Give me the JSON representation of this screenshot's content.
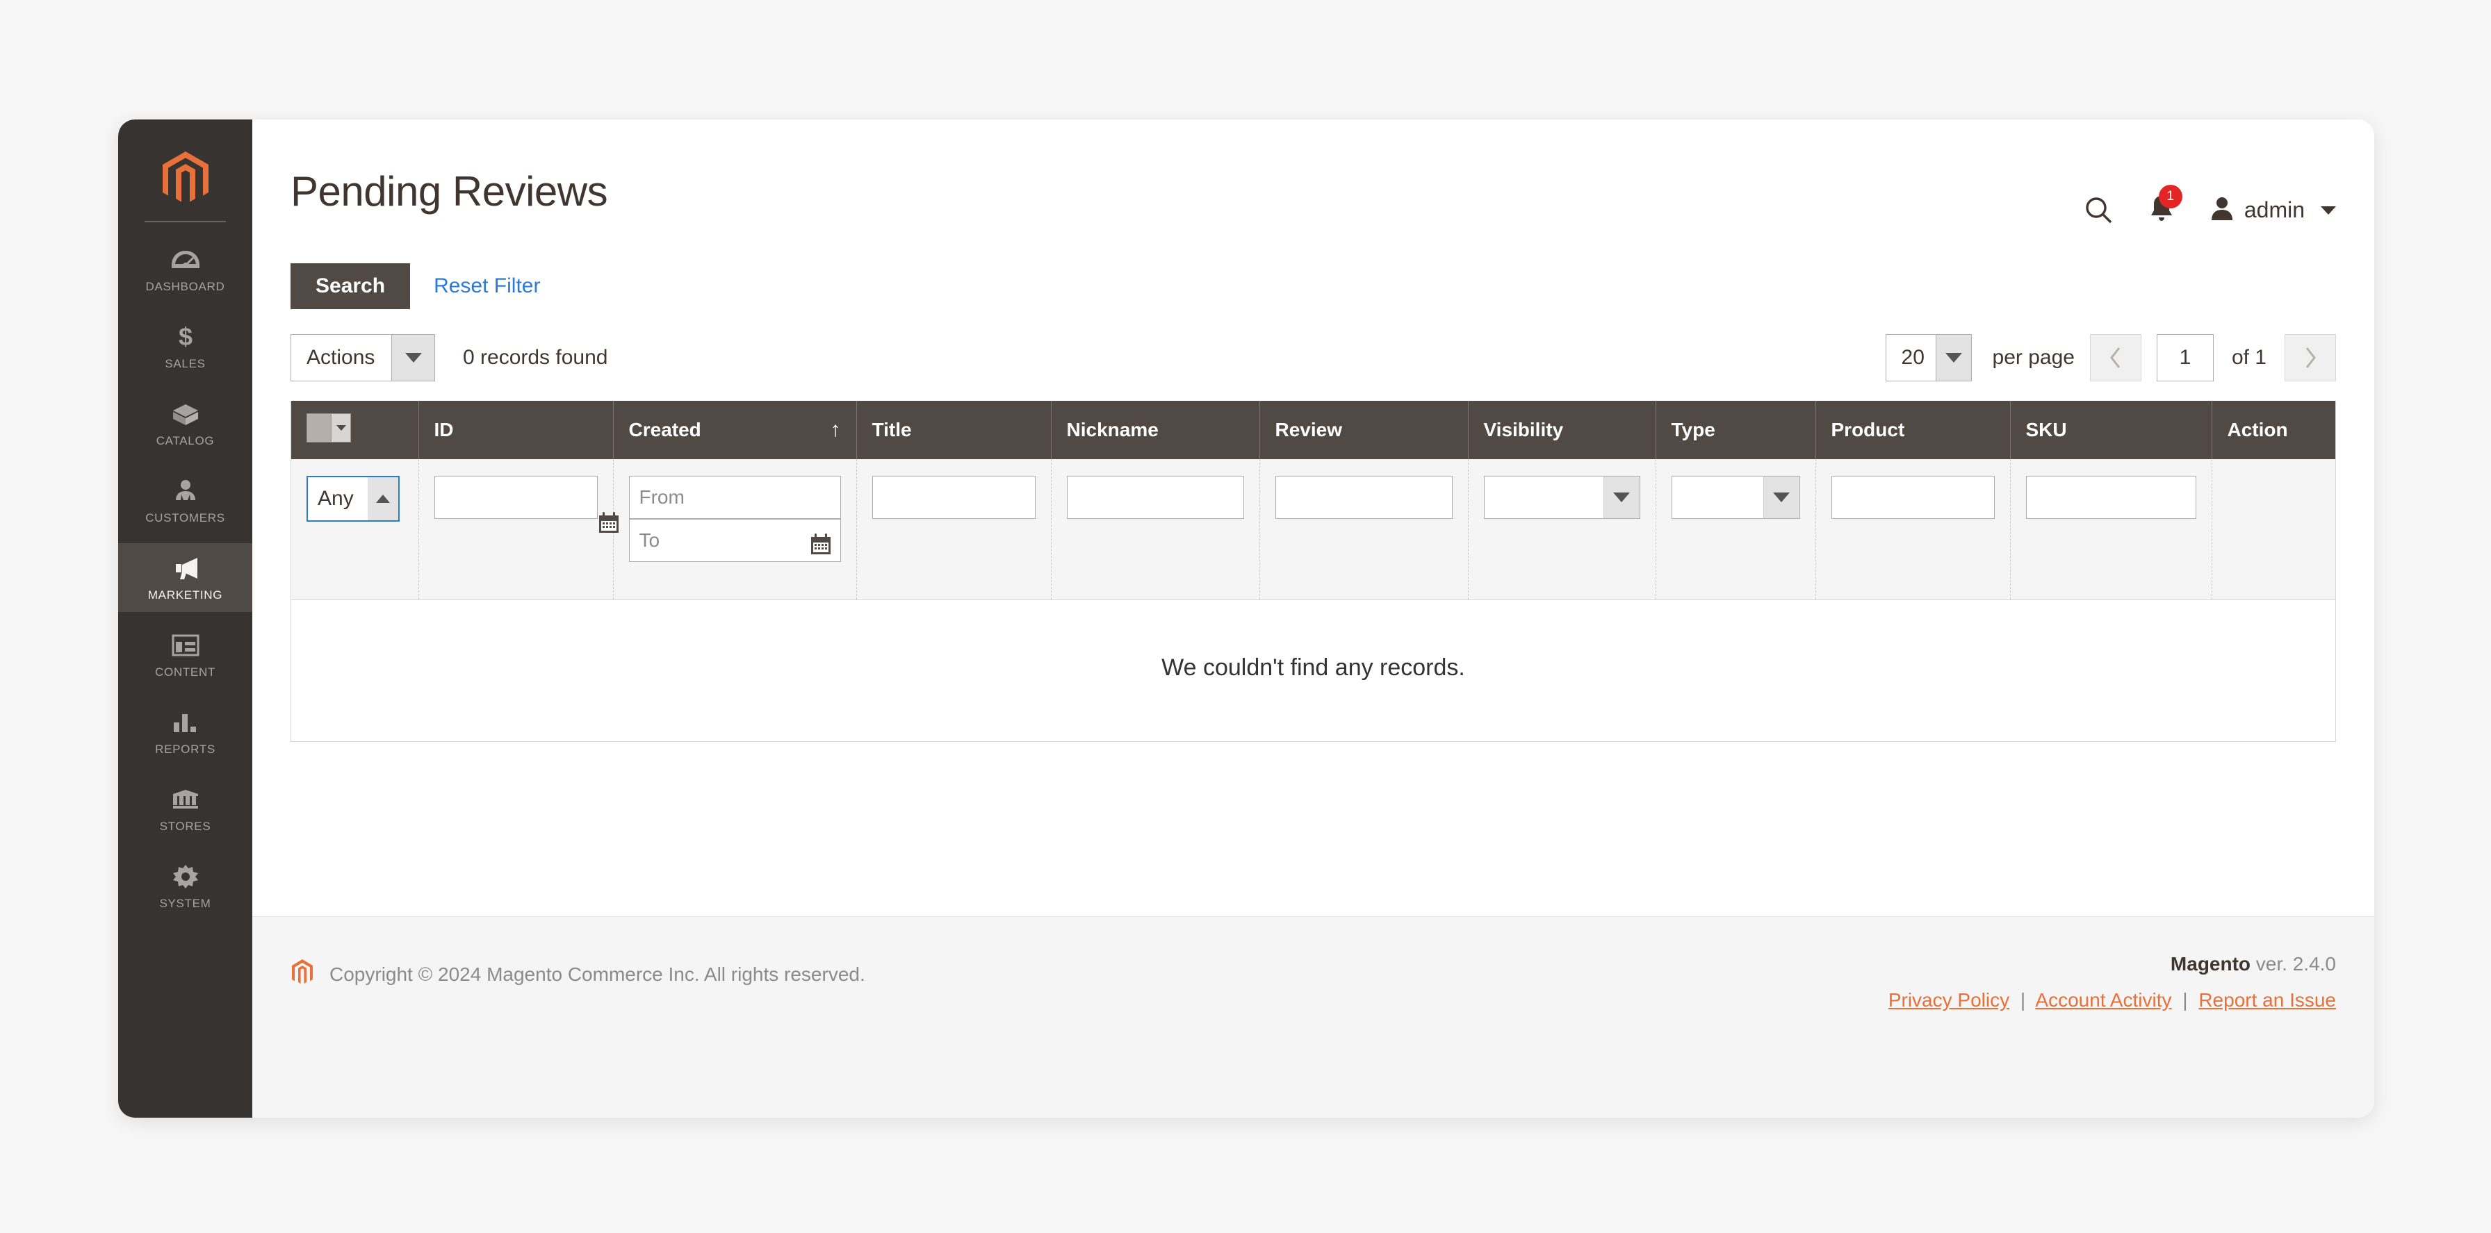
{
  "app": {
    "logo_icon": "magento-logo-icon"
  },
  "sidebar": {
    "items": [
      {
        "label": "DASHBOARD",
        "icon": "dashboard-icon",
        "active": false
      },
      {
        "label": "SALES",
        "icon": "dollar-icon",
        "active": false
      },
      {
        "label": "CATALOG",
        "icon": "box-icon",
        "active": false
      },
      {
        "label": "CUSTOMERS",
        "icon": "people-icon",
        "active": false
      },
      {
        "label": "MARKETING",
        "icon": "megaphone-icon",
        "active": true
      },
      {
        "label": "CONTENT",
        "icon": "layout-icon",
        "active": false
      },
      {
        "label": "REPORTS",
        "icon": "bar-chart-icon",
        "active": false
      },
      {
        "label": "STORES",
        "icon": "storefront-icon",
        "active": false
      },
      {
        "label": "SYSTEM",
        "icon": "gear-icon",
        "active": false
      }
    ]
  },
  "header": {
    "title": "Pending Reviews",
    "search_icon": "search-icon",
    "notifications_icon": "bell-icon",
    "notifications_count": "1",
    "user_icon": "user-avatar-icon",
    "user_name": "admin",
    "user_caret_icon": "chevron-down-icon"
  },
  "search_row": {
    "search_button": "Search",
    "reset_filter_link": "Reset Filter"
  },
  "toolbar": {
    "actions_label": "Actions",
    "actions_caret_icon": "chevron-down-icon",
    "records_found": "0 records found",
    "per_page_value": "20",
    "per_page_caret_icon": "chevron-down-icon",
    "per_page_label": "per page",
    "prev_page_icon": "chevron-left-icon",
    "page_value": "1",
    "of_pages": "of 1",
    "next_page_icon": "chevron-right-icon"
  },
  "grid": {
    "massaction_icon": "massaction-dropdown-icon",
    "columns": [
      {
        "key": "massaction",
        "label": ""
      },
      {
        "key": "id",
        "label": "ID"
      },
      {
        "key": "created",
        "label": "Created",
        "sorted": true,
        "sort_arrow": "↑"
      },
      {
        "key": "title",
        "label": "Title"
      },
      {
        "key": "nickname",
        "label": "Nickname"
      },
      {
        "key": "review",
        "label": "Review"
      },
      {
        "key": "visibility",
        "label": "Visibility"
      },
      {
        "key": "type",
        "label": "Type"
      },
      {
        "key": "product",
        "label": "Product"
      },
      {
        "key": "sku",
        "label": "SKU"
      },
      {
        "key": "action",
        "label": "Action"
      }
    ],
    "filters": {
      "massaction_select_value": "Any",
      "massaction_select_arrow_icon": "chevron-up-icon",
      "id_value": "",
      "created_from_placeholder": "From",
      "created_to_placeholder": "To",
      "calendar_icon": "calendar-icon",
      "title_value": "",
      "nickname_value": "",
      "review_value": "",
      "visibility_value": "",
      "type_value": "",
      "product_value": "",
      "sku_value": ""
    },
    "empty_message": "We couldn't find any records.",
    "rows": []
  },
  "footer": {
    "logo_icon": "magento-logo-icon",
    "copyright": "Copyright © 2024 Magento Commerce Inc. All rights reserved.",
    "brand": "Magento",
    "version": " ver. 2.4.0",
    "links": [
      {
        "label": "Privacy Policy"
      },
      {
        "label": "Account Activity"
      },
      {
        "label": "Report an Issue"
      }
    ],
    "link_separator": "|"
  },
  "colors": {
    "sidebar_bg": "#373330",
    "sidebar_active_bg": "#4f4a46",
    "accent_orange": "#e8703a",
    "header_dark": "#514943",
    "link_blue": "#2b7bd4",
    "badge_red": "#e22626"
  }
}
